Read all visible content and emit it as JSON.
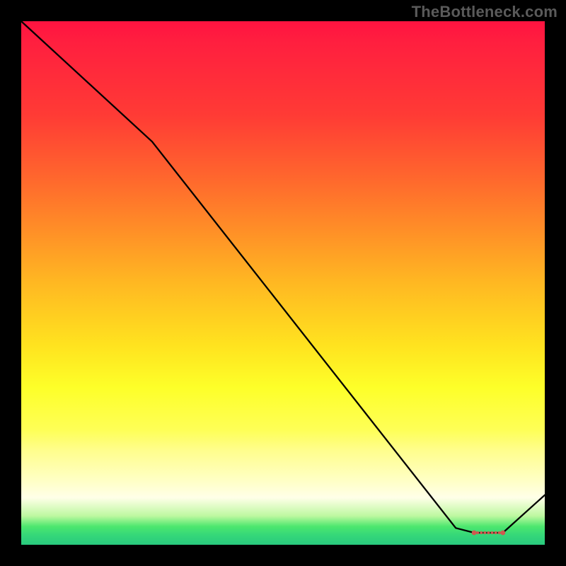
{
  "attribution": "TheBottleneck.com",
  "chart_data": {
    "type": "line",
    "title": "",
    "xlabel": "",
    "ylabel": "",
    "xlim": [
      0,
      100
    ],
    "ylim": [
      0,
      100
    ],
    "grid": false,
    "series": [
      {
        "name": "curve",
        "x": [
          0,
          25,
          83,
          86.5,
          92,
          100
        ],
        "values": [
          100,
          77,
          3.2,
          2.3,
          2.3,
          9.5
        ]
      }
    ],
    "markers": {
      "x_start": 86.5,
      "x_end": 92,
      "y": 2.3,
      "color": "#d0594f"
    },
    "gradient_stops": [
      {
        "pos": 0.0,
        "color": "#ff1340"
      },
      {
        "pos": 0.18,
        "color": "#ff3b35"
      },
      {
        "pos": 0.4,
        "color": "#ff8f27"
      },
      {
        "pos": 0.62,
        "color": "#ffe31f"
      },
      {
        "pos": 0.78,
        "color": "#feff56"
      },
      {
        "pos": 0.91,
        "color": "#ffffe8"
      },
      {
        "pos": 0.965,
        "color": "#4de76e"
      },
      {
        "pos": 1.0,
        "color": "#29c97e"
      }
    ]
  }
}
